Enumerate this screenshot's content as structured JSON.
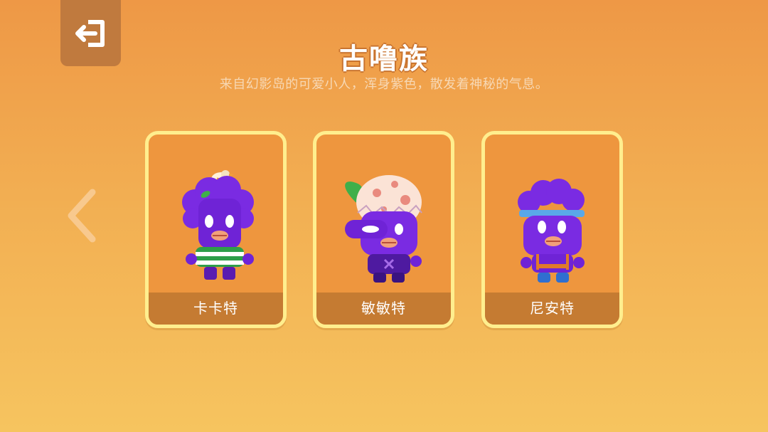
{
  "header": {
    "back_button_icon": "exit-icon",
    "title": "古噜族",
    "subtitle": "来自幻影岛的可爱小人，浑身紫色，散发着神秘的气息。"
  },
  "navigation": {
    "prev_icon": "chevron-left-icon"
  },
  "cards": [
    {
      "name": "卡卡特"
    },
    {
      "name": "敏敏特"
    },
    {
      "name": "尼安特"
    }
  ],
  "colors": {
    "background_top": "#EE9846",
    "background_bottom": "#F6C45F",
    "card_border": "#FFEE8E",
    "card_fill": "#EE963E",
    "card_label_bar": "#C57B32",
    "character_purple": "#7A2BE2"
  }
}
